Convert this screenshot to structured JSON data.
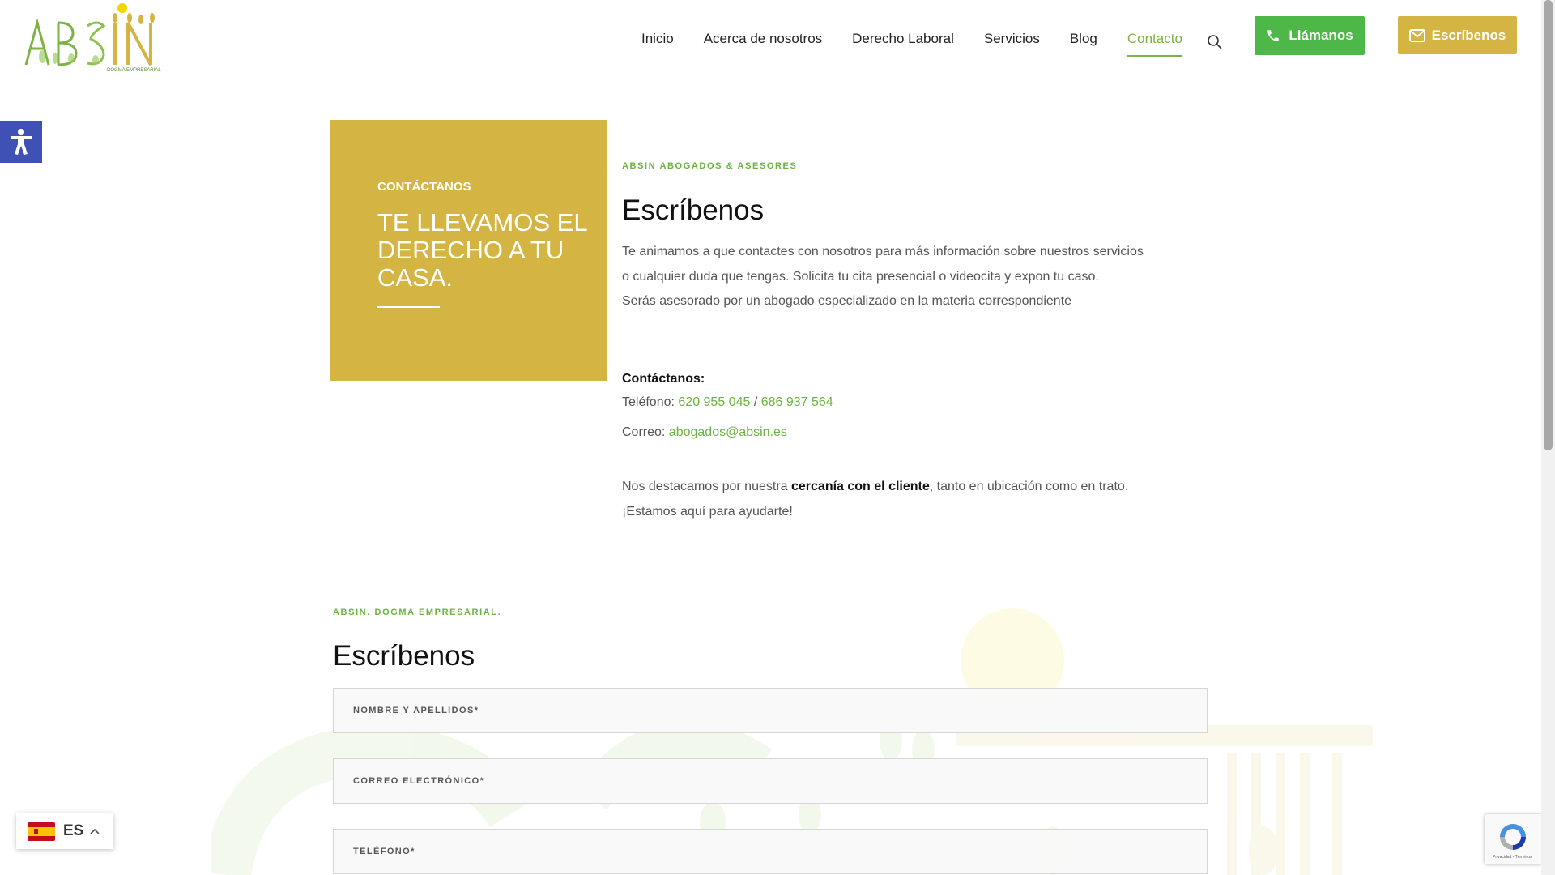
{
  "header": {
    "logo_text": "ABSIN",
    "logo_tagline": "DOGMA EMPRESARIAL",
    "nav": [
      {
        "label": "Inicio"
      },
      {
        "label": "Acerca de nosotros"
      },
      {
        "label": "Derecho Laboral"
      },
      {
        "label": "Servicios"
      },
      {
        "label": "Blog"
      },
      {
        "label": "Contacto",
        "active": true
      }
    ],
    "call_label": "Llámanos",
    "write_label": "Escríbenos"
  },
  "hero": {
    "eyebrow": "CONTÁCTANOS",
    "title": "TE LLEVAMOS EL DERECHO A TU CASA."
  },
  "contact": {
    "label": "ABSIN ABOGADOS & ASESORES",
    "heading": "Escríbenos",
    "intro_1": "Te animamos a que contactes con nosotros para más información sobre nuestros servicios o cualquier duda que tengas. Solicita tu cita presencial o videocita y expon tu caso.",
    "intro_2": "Serás asesorado por un abogado especializado en la materia correspondiente",
    "contact_heading": "Contáctanos:",
    "phone_label": "Teléfono: ",
    "phone_1": "620 955 045",
    "phone_sep": " / ",
    "phone_2": "686 937 564",
    "email_label": "Correo: ",
    "email": "abogados@absin.es",
    "closing_pre": "Nos destacamos por nuestra ",
    "closing_bold": "cercanía con el cliente",
    "closing_post": ", tanto en ubicación como en trato.",
    "closing_2": "¡Estamos aquí para ayudarte!"
  },
  "form": {
    "label": "ABSIN. DOGMA EMPRESARIAL.",
    "heading": "Escríbenos",
    "name_placeholder": "NOMBRE Y APELLIDOS*",
    "email_placeholder": "CORREO ELECTRÓNICO*",
    "phone_placeholder": "TELÉFONO*"
  },
  "language": {
    "code": "ES"
  },
  "recaptcha": {
    "text": "Privacidad - Términos"
  },
  "colors": {
    "green": "#4db848",
    "link_green": "#6cb33f",
    "gold": "#d4b544",
    "accessibility_blue": "#3f51b5"
  }
}
